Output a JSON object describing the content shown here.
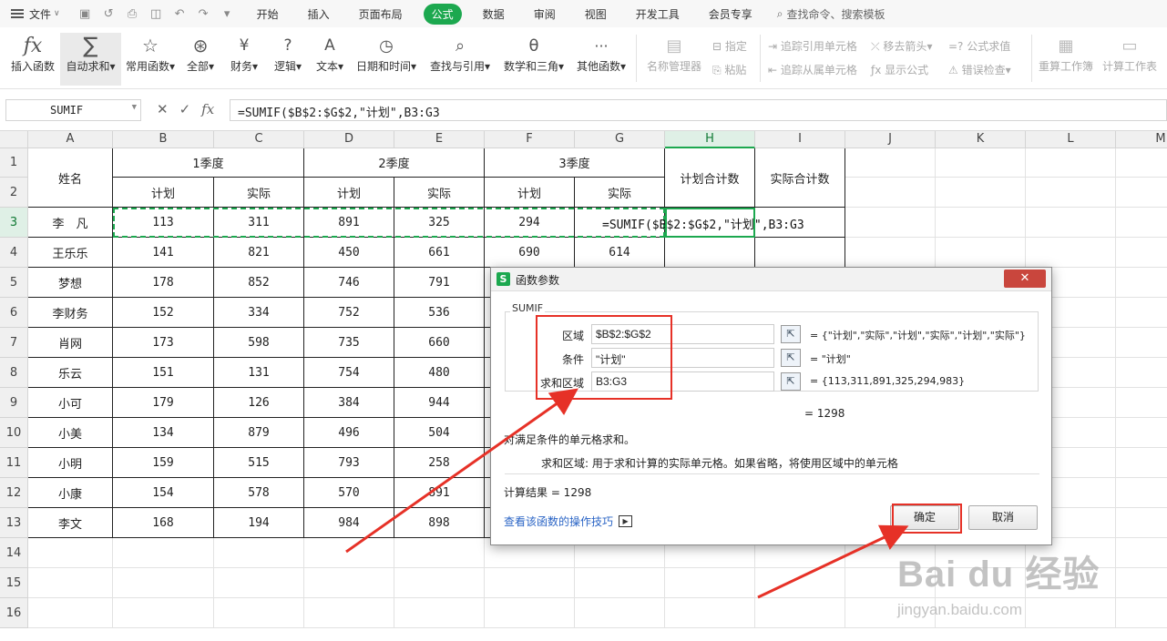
{
  "menubar": {
    "file_label": "文件",
    "tabs": [
      "开始",
      "插入",
      "页面布局",
      "公式",
      "数据",
      "审阅",
      "视图",
      "开发工具",
      "会员专享"
    ],
    "active_tab": "公式",
    "search_label": "查找命令、搜索模板"
  },
  "ribbon": {
    "buttons": [
      {
        "label": "插入函数",
        "icon": "fx-icon"
      },
      {
        "label": "自动求和",
        "icon": "sigma-icon"
      },
      {
        "label": "常用函数",
        "icon": "star-icon"
      },
      {
        "label": "全部",
        "icon": "asterisk-icon"
      },
      {
        "label": "财务",
        "icon": "yen-icon"
      },
      {
        "label": "逻辑",
        "icon": "question-icon"
      },
      {
        "label": "文本",
        "icon": "text-a-icon"
      },
      {
        "label": "日期和时间",
        "icon": "clock-icon"
      },
      {
        "label": "查找与引用",
        "icon": "magnifier-icon"
      },
      {
        "label": "数学和三角",
        "icon": "theta-icon"
      },
      {
        "label": "其他函数",
        "icon": "more-icon"
      },
      {
        "label": "名称管理器",
        "icon": "name-manager-icon"
      }
    ],
    "small": {
      "define": "指定",
      "paste": "粘贴",
      "trace_precedents": "追踪引用单元格",
      "trace_dependents": "追踪从属单元格",
      "remove_arrows": "移去箭头",
      "show_formulas": "显示公式",
      "evaluate": "公式求值",
      "error_check": "错误检查"
    },
    "recalc_book": "重算工作簿",
    "calc_sheet": "计算工作表"
  },
  "formula_bar": {
    "name_box": "SUMIF",
    "formula": "=SUMIF($B$2:$G$2,\"计划\",B3:G3"
  },
  "sheet": {
    "columns": [
      "A",
      "B",
      "C",
      "D",
      "E",
      "F",
      "G",
      "H",
      "I",
      "J",
      "K",
      "L",
      "M"
    ],
    "rows": [
      "1",
      "2",
      "3",
      "4",
      "5",
      "6",
      "7",
      "8",
      "9",
      "10",
      "11",
      "12",
      "13",
      "14",
      "15",
      "16"
    ],
    "header": {
      "name": "姓名",
      "q1": "1季度",
      "q2": "2季度",
      "q3": "3季度",
      "plan": "计划",
      "actual": "实际",
      "plan_total": "计划合计数",
      "actual_total": "实际合计数"
    },
    "data": [
      {
        "name": "李　凡",
        "v": [
          "113",
          "311",
          "891",
          "325",
          "294",
          ""
        ]
      },
      {
        "name": "王乐乐",
        "v": [
          "141",
          "821",
          "450",
          "661",
          "690",
          "614"
        ]
      },
      {
        "name": "梦想",
        "v": [
          "178",
          "852",
          "746",
          "791",
          "",
          ""
        ]
      },
      {
        "name": "李财务",
        "v": [
          "152",
          "334",
          "752",
          "536",
          "",
          ""
        ]
      },
      {
        "name": "肖网",
        "v": [
          "173",
          "598",
          "735",
          "660",
          "",
          ""
        ]
      },
      {
        "name": "乐云",
        "v": [
          "151",
          "131",
          "754",
          "480",
          "",
          ""
        ]
      },
      {
        "name": "小可",
        "v": [
          "179",
          "126",
          "384",
          "944",
          "",
          ""
        ]
      },
      {
        "name": "小美",
        "v": [
          "134",
          "879",
          "496",
          "504",
          "",
          ""
        ]
      },
      {
        "name": "小明",
        "v": [
          "159",
          "515",
          "793",
          "258",
          "",
          ""
        ]
      },
      {
        "name": "小康",
        "v": [
          "154",
          "578",
          "570",
          "891",
          "",
          ""
        ]
      },
      {
        "name": "李文",
        "v": [
          "168",
          "194",
          "984",
          "898",
          "",
          ""
        ]
      }
    ],
    "editing_formula": "=SUMIF($B$2:$G$2,\"计划\",B3:G3"
  },
  "dialog": {
    "title": "函数参数",
    "close_label": "✕",
    "function_name": "SUMIF",
    "args": [
      {
        "label": "区域",
        "value": "$B$2:$G$2",
        "result": "= {\"计划\",\"实际\",\"计划\",\"实际\",\"计划\",\"实际\"}"
      },
      {
        "label": "条件",
        "value": "\"计划\"",
        "result": "= \"计划\""
      },
      {
        "label": "求和区域",
        "value": "B3:G3",
        "result": "= {113,311,891,325,294,983}"
      }
    ],
    "total_result": "= 1298",
    "description": "对满足条件的单元格求和。",
    "arg_help": "求和区域:  用于求和计算的实际单元格。如果省略，将使用区域中的单元格",
    "calc_result": "计算结果 = 1298",
    "help_link": "查看该函数的操作技巧",
    "ok_label": "确定",
    "cancel_label": "取消"
  },
  "watermark": {
    "brand": "Bai du 经验",
    "url": "jingyan.baidu.com"
  },
  "colors": {
    "accent_green": "#1ca84f",
    "annotation_red": "#e63127",
    "link_blue": "#2a64c5"
  }
}
